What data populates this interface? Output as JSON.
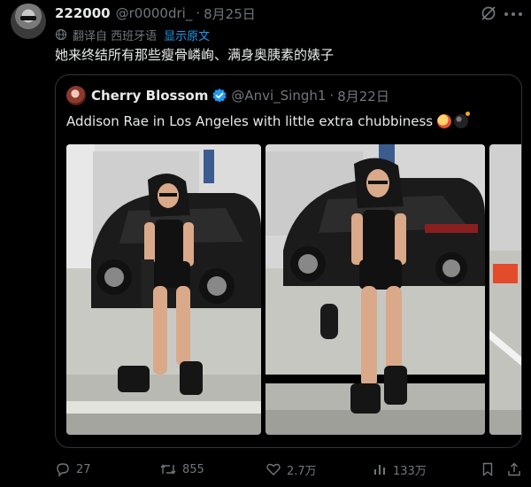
{
  "tweet": {
    "author_name": "222000",
    "handle": "@r0000dri_",
    "separator": "·",
    "date": "8月25日",
    "translated_from": "翻译自 西班牙语",
    "show_original": "显示原文",
    "text": "她来终结所有那些瘦骨嶙峋、满身奥胰素的婊子"
  },
  "quoted": {
    "author_name": "Cherry Blossom",
    "handle": "@Anvi_Singh1",
    "separator": "·",
    "date": "8月22日",
    "text": "Addison Rae in Los Angeles with little extra chubbiness",
    "emojis": [
      "face-hot-icon",
      "bomb-icon"
    ],
    "photos": [
      "photo-1",
      "photo-2",
      "photo-3-partial"
    ]
  },
  "actions": {
    "replies": "27",
    "retweets": "855",
    "likes": "2.7万",
    "views": "133万"
  },
  "colors": {
    "background": "#000000",
    "text": "#e7e9ea",
    "muted": "#71767b",
    "link": "#1d9bf0",
    "border": "#2f3336",
    "verified": "#1d9bf0"
  }
}
